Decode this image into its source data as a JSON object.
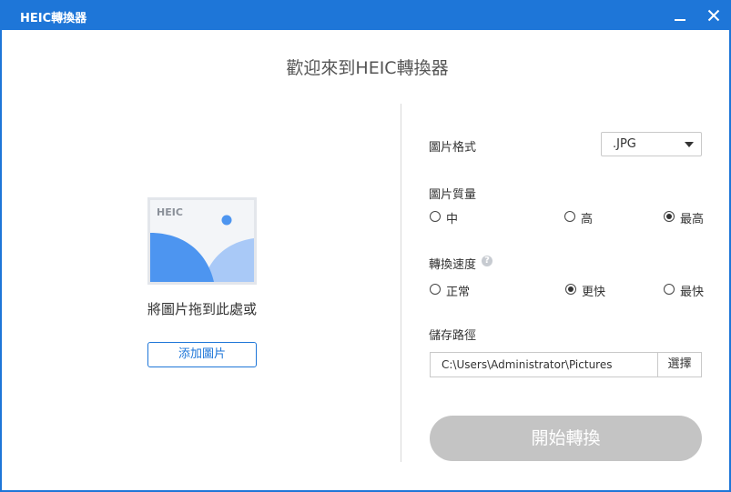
{
  "window": {
    "title": "HEIC轉換器"
  },
  "heading": "歡迎來到HEIC轉換器",
  "dropzone": {
    "badge": "HEIC",
    "text": "將圖片拖到此處或",
    "add_button": "添加圖片"
  },
  "settings": {
    "format": {
      "label": "圖片格式",
      "value": ".JPG"
    },
    "quality": {
      "label": "圖片質量",
      "options": [
        "中",
        "高",
        "最高"
      ],
      "selected": "最高"
    },
    "speed": {
      "label": "轉換速度",
      "options": [
        "正常",
        "更快",
        "最快"
      ],
      "selected": "更快"
    },
    "save_path": {
      "label": "儲存路徑",
      "value": "C:\\Users\\Administrator\\Pictures",
      "browse_button": "選擇"
    }
  },
  "convert_button": "開始轉換",
  "colors": {
    "accent": "#1e76d8",
    "image_blue": "#4d95f0",
    "image_light_blue": "#a9c9f7",
    "disabled_button": "#c4c4c4"
  }
}
